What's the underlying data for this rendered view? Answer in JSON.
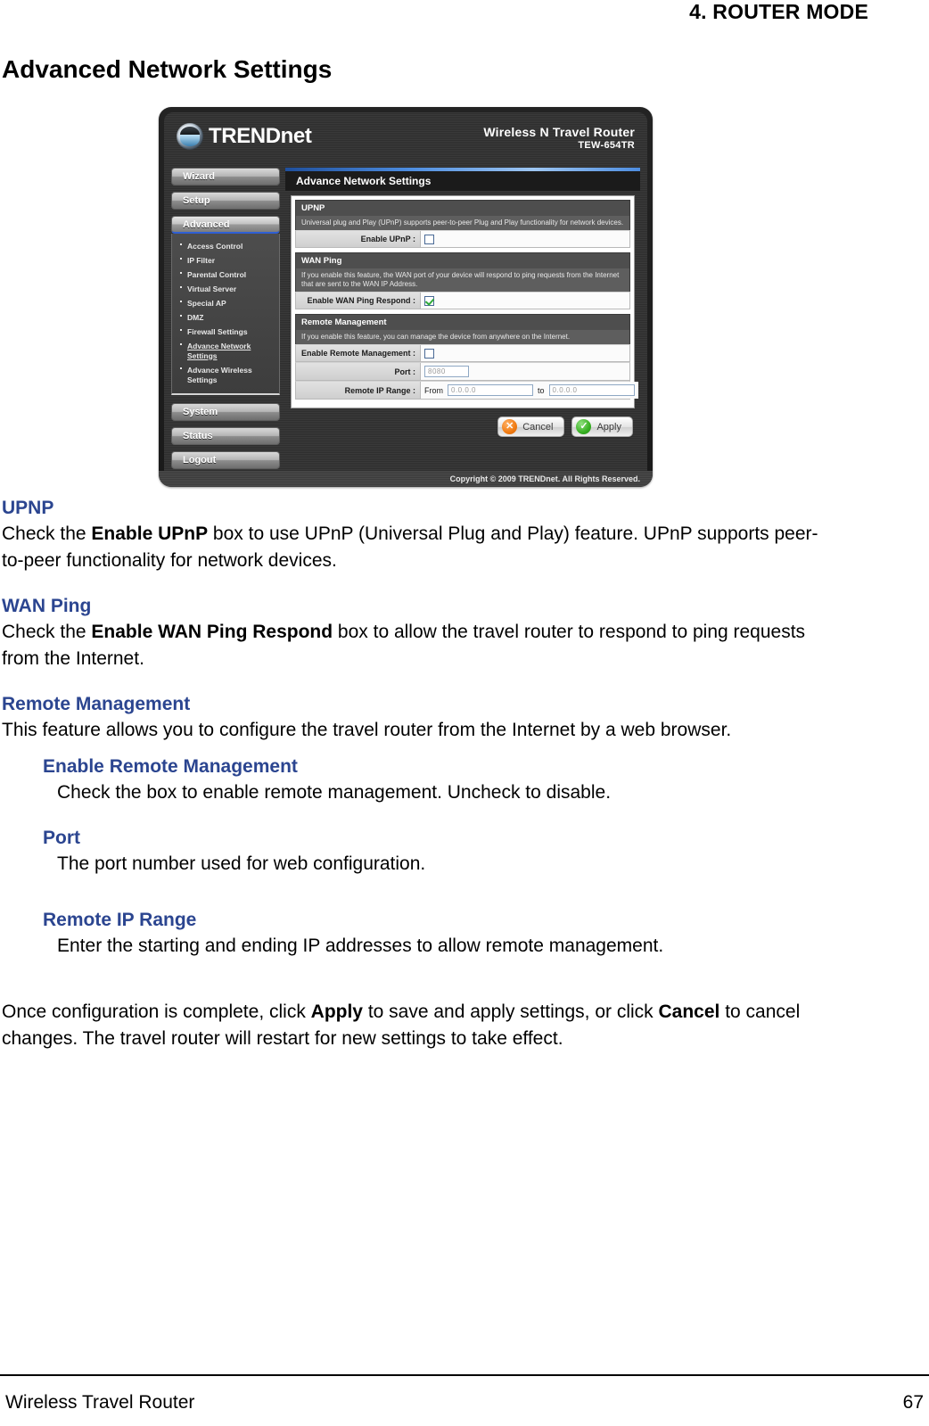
{
  "page": {
    "chapter_title": "4.  ROUTER MODE",
    "section_title": "Advanced Network Settings",
    "footer_left": "Wireless Travel Router",
    "footer_page_number": "67"
  },
  "router_ui": {
    "brand": {
      "name_upper": "TREND",
      "name_lower": "net",
      "product_name": "Wireless N Travel Router",
      "product_model": "TEW-654TR"
    },
    "nav": {
      "buttons_top": [
        {
          "label": "Wizard"
        },
        {
          "label": "Setup"
        }
      ],
      "active_button": "Advanced",
      "submenu": [
        {
          "label": "Access Control",
          "current": false
        },
        {
          "label": "IP Filter",
          "current": false
        },
        {
          "label": "Parental Control",
          "current": false
        },
        {
          "label": "Virtual Server",
          "current": false
        },
        {
          "label": "Special AP",
          "current": false
        },
        {
          "label": "DMZ",
          "current": false
        },
        {
          "label": "Firewall Settings",
          "current": false
        },
        {
          "label": "Advance Network Settings",
          "current": true
        },
        {
          "label": "Advance Wireless Settings",
          "current": false
        }
      ],
      "buttons_bottom": [
        {
          "label": "System"
        },
        {
          "label": "Status"
        },
        {
          "label": "Logout"
        }
      ]
    },
    "panel_title": "Advance Network Settings",
    "groups": {
      "upnp": {
        "heading": "UPNP",
        "description": "Universal plug and Play (UPnP) supports peer-to-peer Plug and Play functionality for network devices.",
        "field_label": "Enable UPnP :",
        "checked": false
      },
      "wan_ping": {
        "heading": "WAN Ping",
        "description": "If you enable this feature, the WAN port of your device will respond to ping requests from the Internet that are sent to the WAN IP Address.",
        "field_label": "Enable WAN Ping Respond :",
        "checked": true
      },
      "remote_management": {
        "heading": "Remote Management",
        "description": "If you enable this feature, you can manage the device from anywhere on the Internet.",
        "enable_label": "Enable Remote Management :",
        "enable_checked": false,
        "port_label": "Port :",
        "port_value": "8080",
        "ip_range_label": "Remote IP Range :",
        "ip_range_from_word": "From",
        "ip_range_from_value": "0.0.0.0",
        "ip_range_to_word": "to",
        "ip_range_to_value": "0.0.0.0"
      }
    },
    "buttons": {
      "cancel": "Cancel",
      "cancel_glyph": "✕",
      "apply": "Apply",
      "apply_glyph": "✓"
    },
    "copyright": "Copyright © 2009 TRENDnet. All Rights Reserved."
  },
  "doc": {
    "upnp": {
      "heading": "UPNP",
      "body_pre": "Check the ",
      "body_bold": "Enable UPnP",
      "body_post": " box to use UPnP (Universal Plug and Play) feature. UPnP supports peer-to-peer functionality for network devices."
    },
    "wan_ping": {
      "heading": "WAN Ping",
      "body_pre": "Check the ",
      "body_bold": "Enable WAN Ping Respond",
      "body_post": " box to allow the travel router to respond to ping requests from the Internet."
    },
    "remote_management": {
      "heading": "Remote Management",
      "body": "This feature allows you to configure the travel router from the Internet by a web browser.",
      "sub_enable": {
        "heading": "Enable Remote Management",
        "body": "Check the box to enable remote management. Uncheck to disable."
      },
      "sub_port": {
        "heading": "Port",
        "body": "The port number used for web configuration."
      },
      "sub_ip_range": {
        "heading": "Remote IP Range",
        "body": "Enter the starting and ending IP addresses to allow remote management."
      }
    },
    "closing": {
      "pre": "Once configuration is complete, click ",
      "bold1": "Apply",
      "mid": " to save and apply settings, or click ",
      "bold2": "Cancel",
      "post": " to cancel changes. The travel router will restart for new settings to take effect."
    }
  }
}
